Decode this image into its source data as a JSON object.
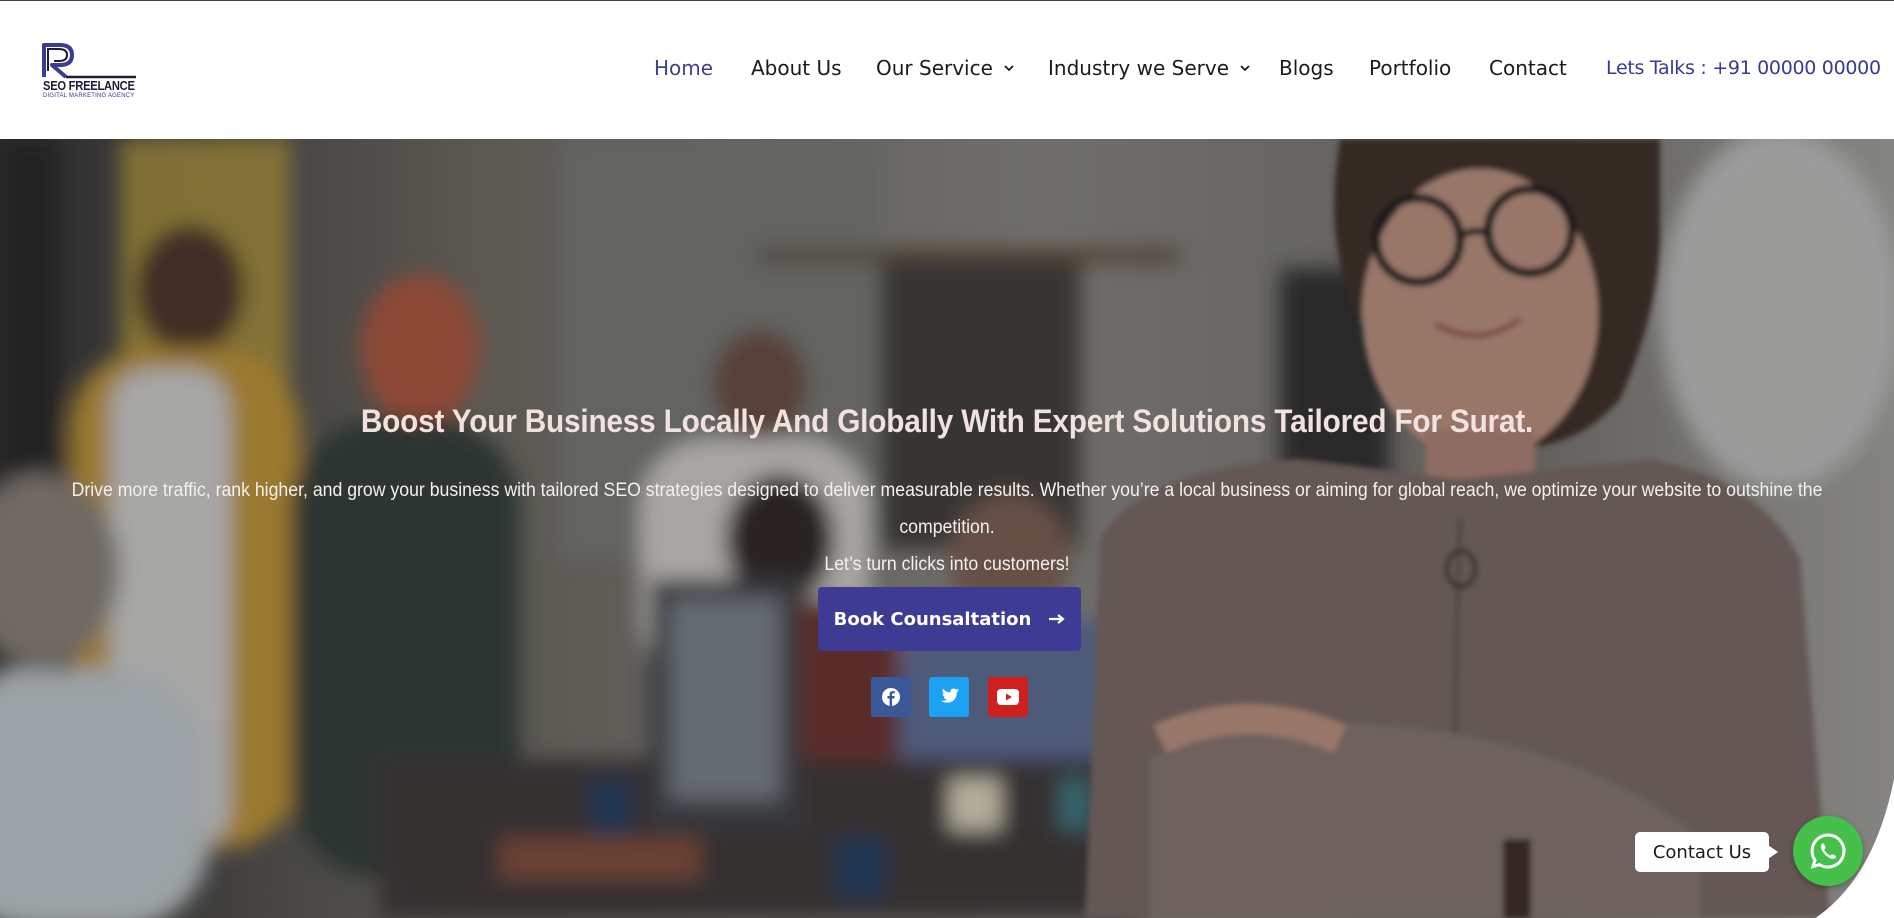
{
  "brand": {
    "logo_name": "SEO FREELANCE",
    "logo_tagline": "DIGITAL MARKETING AGENCY"
  },
  "nav": {
    "items": [
      {
        "label": "Home",
        "active": true
      },
      {
        "label": "About Us"
      },
      {
        "label": "Our Service",
        "dropdown": true
      },
      {
        "label": "Industry we Serve",
        "dropdown": true
      },
      {
        "label": "Blogs"
      },
      {
        "label": "Portfolio"
      },
      {
        "label": "Contact"
      }
    ],
    "cta": "Lets Talks : +91 00000 00000"
  },
  "hero": {
    "title": "Boost Your Business Locally And Globally With Expert Solutions Tailored For Surat.",
    "description_line1": "Drive more traffic, rank higher, and grow your business with tailored SEO strategies designed to deliver measurable results. Whether you’re a local business or aiming for global reach, we optimize your website to outshine the competition.",
    "description_line2": "Let’s turn clicks into customers!",
    "cta_label": "Book Counsaltation",
    "cta_icon": "arrow-right-icon"
  },
  "social": [
    {
      "name": "facebook-icon",
      "color": "#3b5998"
    },
    {
      "name": "twitter-icon",
      "color": "#1da1f2"
    },
    {
      "name": "youtube-icon",
      "color": "#cd201f"
    }
  ],
  "floating": {
    "label": "Contact Us",
    "icon": "whatsapp-icon",
    "color": "#44c04b"
  },
  "colors": {
    "brand": "#3e3b95",
    "nav_active": "#41408f"
  }
}
